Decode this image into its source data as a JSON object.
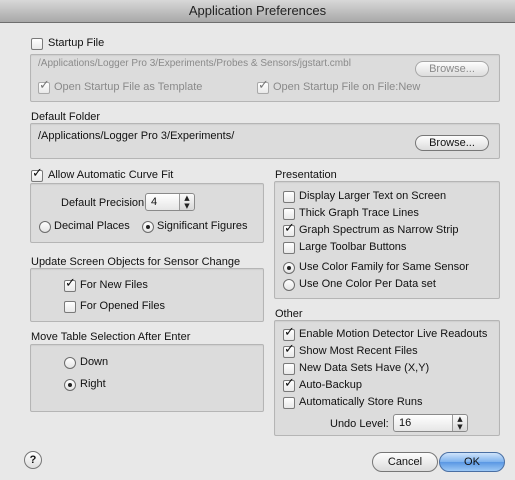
{
  "window": {
    "title": "Application Preferences"
  },
  "startup": {
    "checkbox_label": "Startup File",
    "path": "/Applications/Logger Pro 3/Experiments/Probes & Sensors/jgstart.cmbl",
    "browse_label": "Browse...",
    "open_as_template_label": "Open Startup File as Template",
    "open_on_new_label": "Open Startup File on File:New"
  },
  "default_folder": {
    "title": "Default Folder",
    "path": "/Applications/Logger Pro 3/Experiments/",
    "browse_label": "Browse..."
  },
  "curve_fit": {
    "checkbox_label": "Allow Automatic Curve Fit",
    "precision_label": "Default Precision:",
    "precision_value": "4",
    "decimal_places_label": "Decimal Places",
    "significant_figures_label": "Significant Figures"
  },
  "update_screen": {
    "title": "Update Screen Objects for Sensor Change",
    "for_new_files_label": "For New Files",
    "for_opened_files_label": "For Opened Files"
  },
  "move_table": {
    "title": "Move Table Selection After Enter",
    "down_label": "Down",
    "right_label": "Right"
  },
  "presentation": {
    "title": "Presentation",
    "larger_text_label": "Display Larger Text on Screen",
    "thick_trace_label": "Thick Graph Trace Lines",
    "spectrum_strip_label": "Graph Spectrum as Narrow Strip",
    "large_toolbar_label": "Large Toolbar Buttons",
    "color_family_label": "Use Color Family for Same Sensor",
    "one_color_label": "Use One Color Per Data set"
  },
  "other": {
    "title": "Other",
    "motion_detector_label": "Enable Motion Detector Live Readouts",
    "recent_files_label": "Show Most Recent Files",
    "new_data_sets_label": "New Data Sets Have (X,Y)",
    "auto_backup_label": "Auto-Backup",
    "auto_store_label": "Automatically Store Runs",
    "undo_level_label": "Undo Level:",
    "undo_level_value": "16"
  },
  "footer": {
    "help_label": "?",
    "cancel_label": "Cancel",
    "ok_label": "OK"
  }
}
